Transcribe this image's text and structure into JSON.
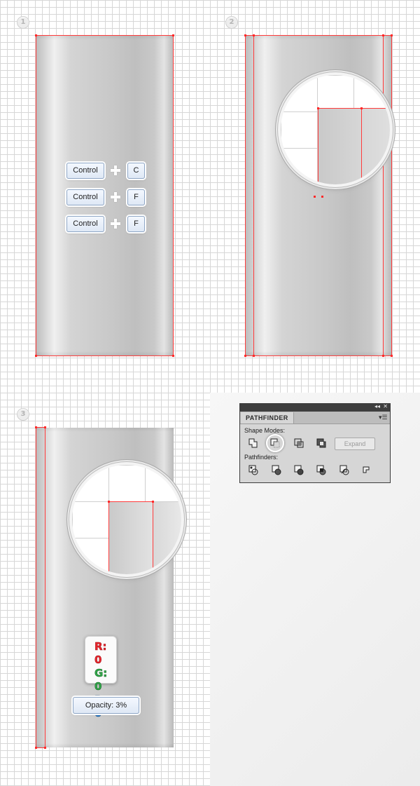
{
  "steps": [
    "1",
    "2",
    "3"
  ],
  "step1": {
    "shortcuts": [
      {
        "modifier": "Control",
        "key": "C"
      },
      {
        "modifier": "Control",
        "key": "F"
      },
      {
        "modifier": "Control",
        "key": "F"
      }
    ]
  },
  "step3": {
    "rgb": {
      "r": "R: 0",
      "g": "G: 0",
      "b": "B: 0"
    },
    "opacity": "Opacity: 3%"
  },
  "pathfinder": {
    "title": "PATHFINDER",
    "collapse_icon": "double-arrow-icon",
    "close_icon": "close-icon",
    "menu_icon": "panel-menu-icon",
    "shape_modes_label": "Shape Modes:",
    "pathfinders_label": "Pathfinders:",
    "expand_label": "Expand",
    "shape_modes": [
      "unite-icon",
      "minus-front-icon",
      "intersect-icon",
      "exclude-icon"
    ],
    "pathfinder_tools": [
      "divide-icon",
      "trim-icon",
      "merge-icon",
      "crop-icon",
      "outline-icon",
      "minus-back-icon"
    ],
    "selected_mode": "minus-front-icon"
  },
  "colors": {
    "guide": "#ff3b3b",
    "r": "#e8262d",
    "g": "#31a64a",
    "b": "#2a7ed0"
  }
}
